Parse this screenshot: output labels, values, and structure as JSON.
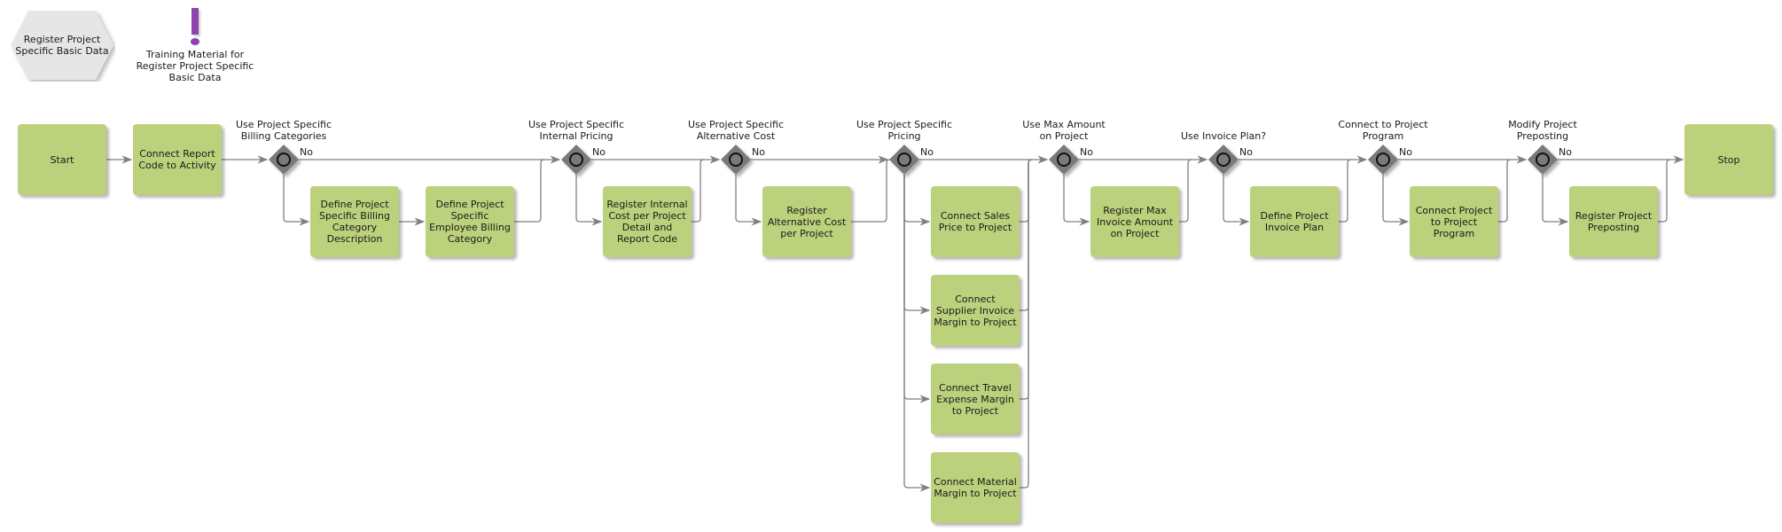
{
  "header": {
    "process_shape": "Register Project Specific Basic Data",
    "training_icon": "exclamation-icon",
    "training_label": "Training Material for Register Project Specific Basic Data"
  },
  "colors": {
    "activity_fill": "#bcd17c",
    "gateway_fill": "#7a7a7a",
    "edge": "#808080",
    "hexagon_fill": "#e6e6e6",
    "training_icon": "#8e44ad"
  },
  "nodes": {
    "start": "Start",
    "connect_report": "Connect Report Code to Activity",
    "stop": "Stop"
  },
  "gateways": [
    {
      "label": "Use Project Specific Billing Categories",
      "no": "No",
      "activities": [
        "Define Project Specific Billing Category Description",
        "Define Project Specific Employee Billing Category"
      ]
    },
    {
      "label": "Use Project Specific Internal Pricing",
      "no": "No",
      "activities": [
        "Register Internal Cost per Project Detail and Report Code"
      ]
    },
    {
      "label": "Use Project Specific Alternative Cost",
      "no": "No",
      "activities": [
        "Register Alternative Cost per Project"
      ]
    },
    {
      "label": "Use Project Specific Pricing",
      "no": "No",
      "activities": [
        "Connect Sales Price to Project",
        "Connect Supplier Invoice Margin to Project",
        "Connect Travel Expense Margin to Project",
        "Connect Material Margin to Project"
      ]
    },
    {
      "label": "Use Max Amount on Project",
      "no": "No",
      "activities": [
        "Register Max Invoice Amount on Project"
      ]
    },
    {
      "label": "Use Invoice Plan?",
      "no": "No",
      "activities": [
        "Define Project Invoice Plan"
      ]
    },
    {
      "label": "Connect to Project Program",
      "no": "No",
      "activities": [
        "Connect Project to Project Program"
      ]
    },
    {
      "label": "Modify Project Preposting",
      "no": "No",
      "activities": [
        "Register Project Preposting"
      ]
    }
  ]
}
